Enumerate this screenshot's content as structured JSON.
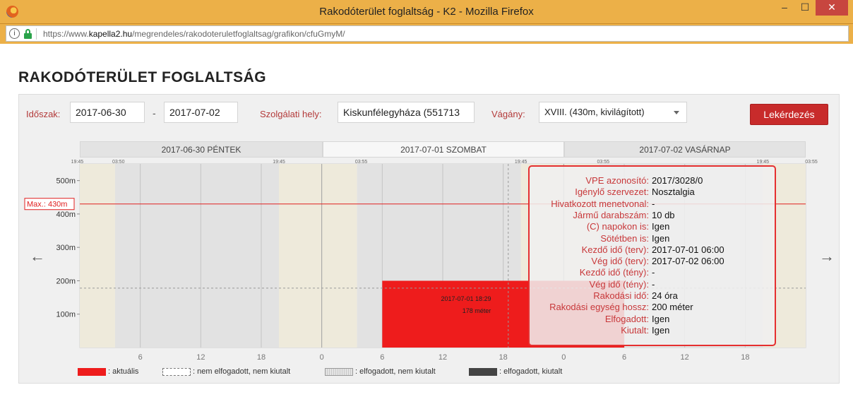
{
  "window": {
    "title": "Rakodóterület foglaltság - K2 - Mozilla Firefox",
    "url_prefix": "https://www.",
    "url_domain": "kapella2.hu",
    "url_path": "/megrendeles/rakodoteruletfoglaltsag/grafikon/cfuGmyM/",
    "minimize": "–",
    "maximize": "☐",
    "close": "✕"
  },
  "page": {
    "title": "RAKODÓTERÜLET FOGLALTSÁG"
  },
  "filters": {
    "period_label": "Időszak:",
    "date_from": "2017-06-30",
    "dash": "-",
    "date_to": "2017-07-02",
    "location_label": "Szolgálati hely:",
    "location_value": "Kiskunfélegyháza (551713",
    "track_label": "Vágány:",
    "track_value": "XVIII. (430m, kivilágított)",
    "query_button": "Lekérdezés"
  },
  "nav": {
    "prev": "←",
    "next": "→"
  },
  "days": [
    "2017-06-30  PÉNTEK",
    "2017-07-01  SZOMBAT",
    "2017-07-02  VASÁRNAP"
  ],
  "chart_data": {
    "type": "bar",
    "x_unit": "hour",
    "x_ticks": [
      "6",
      "12",
      "18",
      "0",
      "6",
      "12",
      "18",
      "0",
      "6",
      "12",
      "18"
    ],
    "top_ticks": [
      "19:45",
      "03:50",
      "19:45",
      "03:55",
      "19:45",
      "03:55",
      "19:45",
      "03:55"
    ],
    "y_ticks": [
      "100m",
      "200m",
      "300m",
      "400m",
      "500m"
    ],
    "ylim": [
      0,
      550
    ],
    "max_line_value": 430,
    "max_line_label": "Max.: 430m",
    "dashed_line_value": 178,
    "bars": [
      {
        "start": "2017-07-01 06:00",
        "end": "2017-07-02 06:00",
        "value": 200,
        "type": "aktuális"
      }
    ],
    "hover_label": {
      "time": "2017-07-01 18:29",
      "value": "178 méter"
    }
  },
  "legend": [
    {
      "label": ": aktuális",
      "color": "#ee1c1c"
    },
    {
      "label": ": nem elfogadott, nem kiutalt",
      "color": "#ffffff"
    },
    {
      "label": ": elfogadott, nem kiutalt",
      "color": "#dddddd"
    },
    {
      "label": ": elfogadott, kiutalt",
      "color": "#444444"
    }
  ],
  "tooltip": {
    "rows": [
      {
        "key": "VPE azonosító:",
        "value": "2017/3028/0"
      },
      {
        "key": "Igénylő szervezet:",
        "value": "Nosztalgia"
      },
      {
        "key": "Hivatkozott menetvonal:",
        "value": "-"
      },
      {
        "key": "Jármű darabszám:",
        "value": "10 db"
      },
      {
        "key": "(C) napokon is:",
        "value": "Igen"
      },
      {
        "key": "Sötétben is:",
        "value": "Igen"
      },
      {
        "key": "Kezdő idő (terv):",
        "value": "2017-07-01 06:00"
      },
      {
        "key": "Vég idő (terv):",
        "value": "2017-07-02 06:00"
      },
      {
        "key": "Kezdő idő (tény):",
        "value": "-"
      },
      {
        "key": "Vég idő (tény):",
        "value": "-"
      },
      {
        "key": "Rakodási idő:",
        "value": "24 óra"
      },
      {
        "key": "Rakodási egység hossz:",
        "value": "200 méter"
      },
      {
        "key": "Elfogadott:",
        "value": "Igen"
      },
      {
        "key": "Kiutalt:",
        "value": "Igen"
      }
    ]
  }
}
